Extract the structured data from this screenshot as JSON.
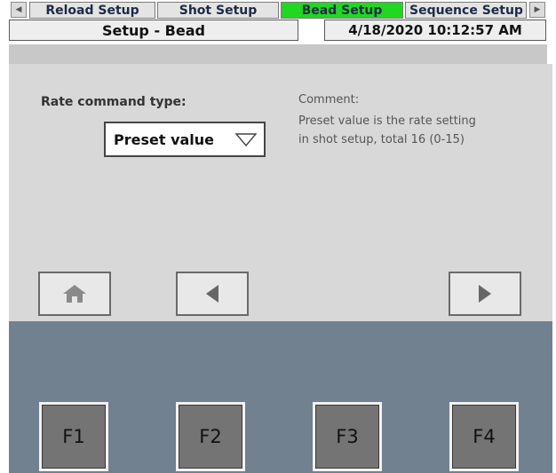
{
  "header": {
    "title": "Setup - Bead",
    "datetime": "4/18/2020 10:12:57 AM"
  },
  "tabs": [
    {
      "label": "Reload Setup",
      "active": false
    },
    {
      "label": "Shot Setup",
      "active": false
    },
    {
      "label": "Bead Setup",
      "active": true
    },
    {
      "label": "Sequence Setup",
      "active": false
    }
  ],
  "main": {
    "rate_label": "Rate command type:",
    "rate_value": "Preset value",
    "comment_heading": "Comment:",
    "comment_line1": "Preset value is the rate setting",
    "comment_line2": "in shot setup, total 16 (0-15)"
  },
  "nav": {
    "home_icon": "home-icon",
    "back_icon": "triangle-left-icon",
    "forward_icon": "triangle-right-icon"
  },
  "function_keys": [
    "F1",
    "F2",
    "F3",
    "F4"
  ],
  "colors": {
    "active_tab": "#20d820",
    "panel_bg": "#d8d8d8",
    "slate_bg": "#728190",
    "fkey_bg": "#747474"
  }
}
